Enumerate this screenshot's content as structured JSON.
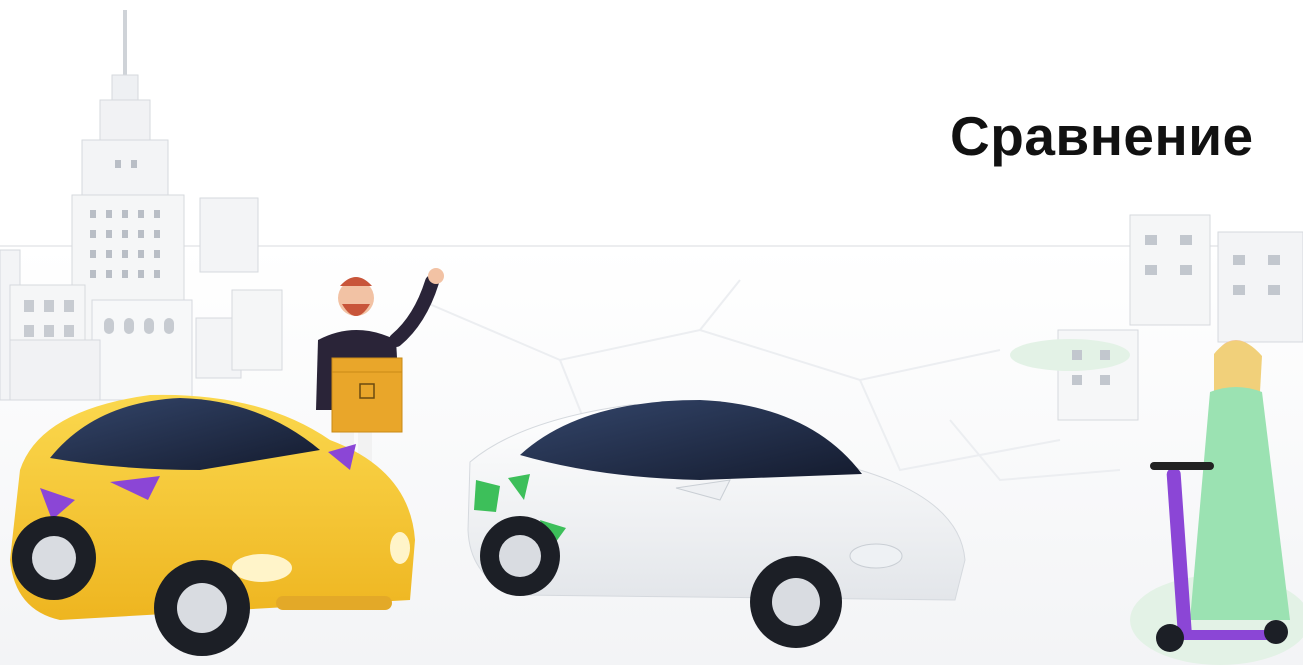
{
  "page": {
    "title": "Сравнение"
  },
  "illustration": {
    "colors": {
      "yellow_car": "#f6c935",
      "white_car": "#f4f5f6",
      "roof": "#1f2a44",
      "accent_purple": "#8b46d6",
      "accent_green": "#3dbf5a",
      "dress": "#9be2b2",
      "box": "#e9a62a"
    }
  }
}
